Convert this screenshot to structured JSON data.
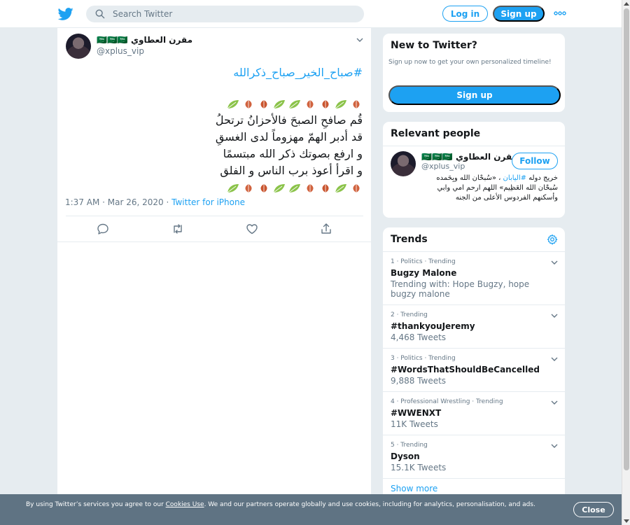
{
  "header": {
    "search_placeholder": "Search Twitter",
    "login_label": "Log in",
    "signup_label": "Sign up",
    "logo_icon": "twitter-bird-icon",
    "more_icon": "more-dots-icon"
  },
  "tweet": {
    "author_name": "مقرن العطاوي 🇸🇦🇸🇦🇸🇦",
    "author_handle": "@xplus_vip",
    "hashtag": "#صباح_الخير_صباح_ذكرالله",
    "lines": [
      "قُم صافحِ الصبحَ فالأحزانُ ترتحلُ",
      "قد أدبر الهمّ مهزوماً لدى الغسقِ",
      "و ارفع بصوتك ذكر الله مبتسمًا",
      "و اقرأ أعوذ برب الناس و الفلق"
    ],
    "time": "1:37 AM · Mar 26, 2020",
    "separator": " · ",
    "source": "Twitter for iPhone"
  },
  "new_to_twitter": {
    "title": "New to Twitter?",
    "subtitle": "Sign up now to get your own personalized timeline!",
    "signup_label": "Sign up"
  },
  "relevant": {
    "title": "Relevant people",
    "name": "مقرن العطاوي 🇸🇦🇸🇦🇸🇦",
    "handle": "@xplus_vip",
    "follow_label": "Follow",
    "bio_prefix": "خريج دوله ",
    "bio_link": "#اليابان",
    "bio_rest": " ، «سُبحْان الله وبِحَمده سُبحْان الله العَظِيم» اللهم ارحم امي وابي وأسكنهم الفردوس الأعلى من الجنه"
  },
  "trends": {
    "title": "Trends",
    "items": [
      {
        "context": "1 · Politics · Trending",
        "name": "Bugzy Malone",
        "info": "Trending with: Hope Bugzy, hope bugzy malone"
      },
      {
        "context": "2 · Trending",
        "name": "#thankyouJeremy",
        "info": "4,468 Tweets"
      },
      {
        "context": "3 · Politics · Trending",
        "name": "#WordsThatShouldBeCancelled",
        "info": "9,888 Tweets"
      },
      {
        "context": "4 · Professional Wrestling · Trending",
        "name": "#WWENXT",
        "info": "11K Tweets"
      },
      {
        "context": "5 · Trending",
        "name": "Dyson",
        "info": "15.1K Tweets"
      }
    ],
    "show_more": "Show more"
  },
  "cookie": {
    "text_before": "By using Twitter’s services you agree to our ",
    "link": "Cookies Use",
    "text_after": ". We and our partners operate globally and use cookies, including for analytics, personalisation, and ads.",
    "close_label": "Close"
  },
  "colors": {
    "accent": "#1da1f2",
    "background": "#e6ecf0",
    "banner": "#5f7383"
  }
}
